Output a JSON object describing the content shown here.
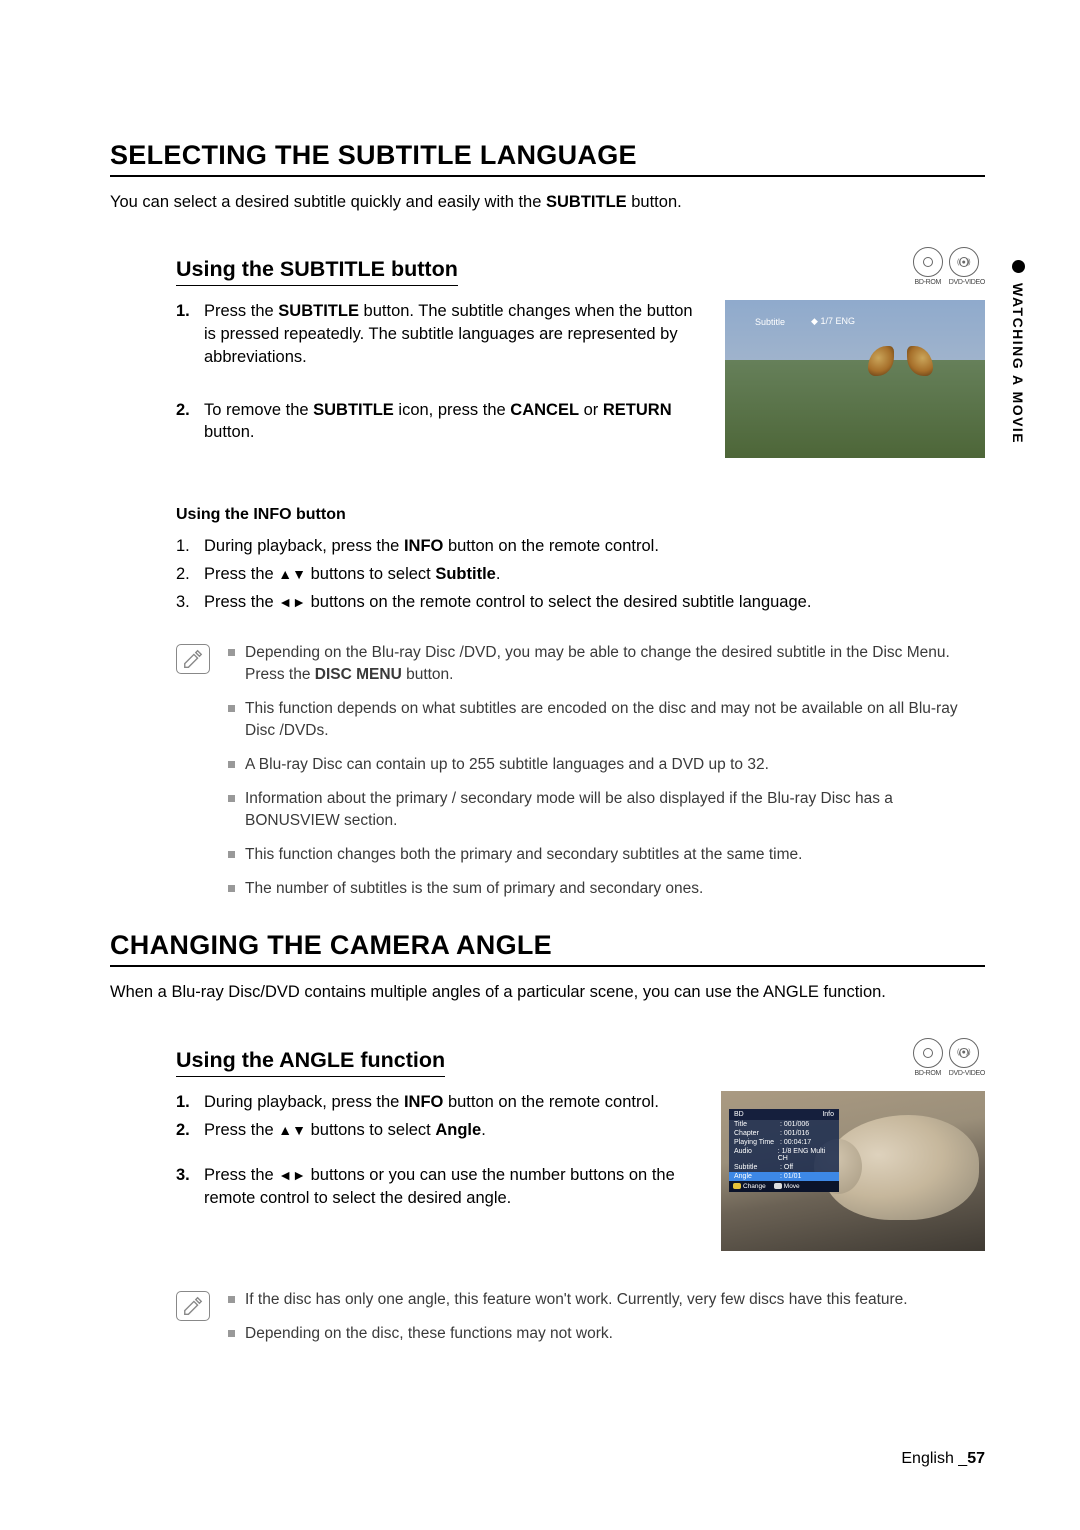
{
  "side_tab": "WATCHING A MOVIE",
  "s1": {
    "title": "SELECTING THE SUBTITLE LANGUAGE",
    "intro_pre": "You can select a desired subtitle quickly and easily with the ",
    "intro_bold": "SUBTITLE",
    "intro_post": " button.",
    "sub_heading": "Using the SUBTITLE button",
    "disc_labels": {
      "bd": "BD-ROM",
      "dvd": "DVD-VIDEO"
    },
    "step1_a": "Press the ",
    "step1_b1": "SUBTITLE",
    "step1_b": " button. The subtitle changes when the button is pressed repeatedly. The subtitle languages are represented by abbreviations.",
    "step2_a": "To remove the ",
    "step2_b1": "SUBTITLE",
    "step2_b": " icon, press the ",
    "step2_b2": "CANCEL",
    "step2_c": " or ",
    "step2_b3": "RETURN",
    "step2_d": " button.",
    "osd_label": "Subtitle",
    "osd_value": "1/7 ENG",
    "info_heading": "Using the INFO button",
    "info1_a": "During playback, press the ",
    "info1_b": "INFO",
    "info1_c": " button on the remote control.",
    "info2_a": "Press the  ",
    "info2_b": " buttons to select ",
    "info2_c": "Subtitle",
    "info2_d": ".",
    "info3_a": "Press the ",
    "info3_b": " buttons on the remote control to select the desired subtitle language.",
    "notes": [
      {
        "pre": "Depending on the Blu-ray Disc /DVD, you may be able to change the desired subtitle in the Disc Menu. Press the ",
        "b": "DISC MENU",
        "post": " button."
      },
      {
        "pre": "This function depends on what subtitles are encoded on the disc and may not be available on all Blu-ray Disc /DVDs."
      },
      {
        "pre": "A Blu-ray Disc can contain up to 255 subtitle languages and a DVD up to 32."
      },
      {
        "pre": "Information about the primary / secondary mode will be also displayed if the Blu-ray Disc has a BONUSVIEW section."
      },
      {
        "pre": "This function changes both the primary and secondary subtitles at the same time."
      },
      {
        "pre": "The number of subtitles is the sum of primary and secondary ones."
      }
    ]
  },
  "s2": {
    "title": "CHANGING THE CAMERA ANGLE",
    "intro": "When a Blu-ray Disc/DVD contains multiple angles of a particular scene, you can use the ANGLE function.",
    "sub_heading": "Using the ANGLE function",
    "disc_labels": {
      "bd": "BD-ROM",
      "dvd": "DVD-VIDEO"
    },
    "step1_a": "During playback, press the ",
    "step1_b": "INFO",
    "step1_c": " button on the remote control.",
    "step2_a": "Press the ",
    "step2_b": " buttons to select ",
    "step2_c": "Angle",
    "step2_d": ".",
    "step3_a": "Press the ",
    "step3_b": " buttons or you can use the number buttons on the remote control to select the desired angle.",
    "panel": {
      "head_l": "BD",
      "head_r": "Info",
      "rows": [
        {
          "k": "Title",
          "v": ": 001/006"
        },
        {
          "k": "Chapter",
          "v": ": 001/016"
        },
        {
          "k": "Playing Time",
          "v": ": 00:04:17"
        },
        {
          "k": "Audio",
          "v": ": 1/8 ENG Multi CH"
        },
        {
          "k": "Subtitle",
          "v": ": Off"
        }
      ],
      "sel": {
        "k": "Angle",
        "v": ": 01/01"
      },
      "foot_l": "Change",
      "foot_r": "Move"
    },
    "notes": [
      {
        "pre": "If the disc has only one angle, this feature won't work. Currently, very few discs have this feature."
      },
      {
        "pre": "Depending on the disc, these functions may not work."
      }
    ]
  },
  "footer": {
    "lang": "English ",
    "sep": "_",
    "page": "57"
  }
}
